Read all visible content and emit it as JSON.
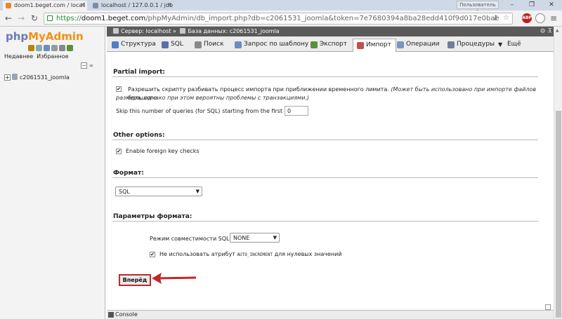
{
  "browser": {
    "tabs": [
      {
        "title": "doom1.beget.com / locall"
      },
      {
        "title": "localhost / 127.0.0.1 / jdb"
      }
    ],
    "user_label": "Пользователь 1",
    "window_controls": {
      "minimize": "–",
      "maximize": "❐",
      "close": "✕"
    },
    "url": {
      "scheme": "https://",
      "host": "doom1.beget.com",
      "path": "/phpMyAdmin/db_import.php?db=c2061531_joomla&token=7e7680394a8ba28edd410f9d017e0bae"
    },
    "extensions": [
      {
        "name": "adblock-icon",
        "label": "ABP",
        "color": "#c11b1b"
      },
      {
        "name": "sync-icon",
        "label": "",
        "color": "#8a8a8a"
      }
    ]
  },
  "sidebar": {
    "logo": {
      "php": "php",
      "my": "My",
      "admin": "Admin"
    },
    "recent_label": "Недавнее",
    "favorites_label": "Избранное",
    "collapse_label": "−",
    "link_label": "∞",
    "databases": [
      {
        "name": "c2061531_joomla"
      }
    ]
  },
  "header": {
    "breadcrumb": {
      "server_label": "Сервер: localhost »",
      "database_label": "База данных: c2061531_joomla"
    },
    "settings_icon": "⚙",
    "collapse_icon": "⊼"
  },
  "tabs": [
    {
      "label": "Структура",
      "icon": "structure-icon",
      "color": "#4d7fc2"
    },
    {
      "label": "SQL",
      "icon": "sql-icon",
      "color": "#5a6fa8"
    },
    {
      "label": "Поиск",
      "icon": "search-icon",
      "color": "#8a8a8a"
    },
    {
      "label": "Запрос по шаблону",
      "icon": "query-icon",
      "color": "#6c8cc1"
    },
    {
      "label": "Экспорт",
      "icon": "export-icon",
      "color": "#5b8f3e"
    },
    {
      "label": "Импорт",
      "icon": "import-icon",
      "color": "#c0504d",
      "active": true
    },
    {
      "label": "Операции",
      "icon": "wrench-icon",
      "color": "#7a96c0"
    },
    {
      "label": "Процедуры",
      "icon": "procedures-icon",
      "color": "#6f7f99"
    },
    {
      "label": "Ещё",
      "icon": "chevron-down-icon",
      "color": "#444"
    }
  ],
  "partial_import": {
    "title": "Partial import:",
    "allow_interrupt_checked": true,
    "allow_interrupt_text": "Разрешить скрипту разбивать процесс импорта при приближении временного лимита.",
    "allow_interrupt_note_1": "(Может быть использовано при импорте файлов большого",
    "allow_interrupt_note_2": "размера, однако при этом вероятны проблемы с транзакциями.)",
    "skip_label": "Skip this number of queries (for SQL) starting from the first one:",
    "skip_value": "0"
  },
  "other_options": {
    "title": "Other options:",
    "fk_checked": true,
    "fk_label": "Enable foreign key checks"
  },
  "format": {
    "title": "Формат:",
    "selected": "SQL"
  },
  "format_options": {
    "title": "Параметры формата:",
    "compat_label": "Режим совместимости SQL:",
    "compat_value": "NONE",
    "no_auto_inc_checked": true,
    "no_auto_inc_prefix": "Не использовать атрибут",
    "no_auto_inc_code": "AUTO_INCREMENT",
    "no_auto_inc_suffix": "для нулевых значений"
  },
  "submit": {
    "label": "Вперёд"
  },
  "console": {
    "label": "Console"
  },
  "colors": {
    "accent_red": "#c0282a",
    "breadcrumb_bg": "#5a5a5a",
    "logo_php": "#6c78af",
    "logo_myadmin": "#f29111",
    "https_green": "#1e8a2a"
  }
}
